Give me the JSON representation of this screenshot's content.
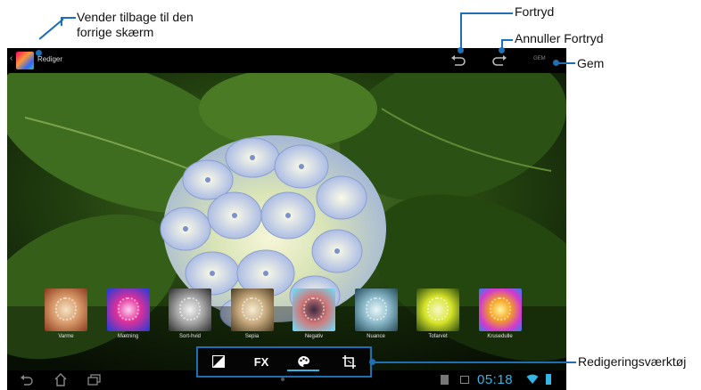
{
  "actionbar": {
    "title": "Rediger",
    "save_label": "GEM"
  },
  "annotations": {
    "back": "Vender tilbage til den forrige skærm",
    "back_line1": "Vender tilbage til den",
    "back_line2": "forrige skærm",
    "undo": "Fortryd",
    "redo": "Annuller Fortryd",
    "save": "Gem",
    "tools": "Redigeringsværktøj"
  },
  "effects": [
    {
      "label": "Varme"
    },
    {
      "label": "Mætning"
    },
    {
      "label": "Sort-hvid"
    },
    {
      "label": "Sepia"
    },
    {
      "label": "Negativ"
    },
    {
      "label": "Nuance"
    },
    {
      "label": "Tofarvet"
    },
    {
      "label": "Krusedulle"
    }
  ],
  "toolbar": {
    "fx_label": "FX",
    "selected_tool": "color-effects"
  },
  "statusbar": {
    "time": "05:18"
  },
  "colors": {
    "callout": "#1f6fb5",
    "clock": "#33b5e5",
    "selected_underline": "#33b5e5"
  }
}
